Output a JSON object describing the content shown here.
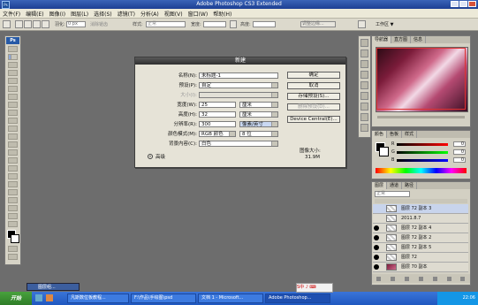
{
  "titlebar": {
    "title": "Adobe Photoshop CS3 Extended"
  },
  "menubar": {
    "items": [
      "文件(F)",
      "编辑(E)",
      "图像(I)",
      "图层(L)",
      "选择(S)",
      "滤镜(T)",
      "分析(A)",
      "视图(V)",
      "窗口(W)",
      "帮助(H)"
    ]
  },
  "optbar": {
    "feather_label": "羽化:",
    "feather_value": "0 px",
    "antialias_label": "消除锯齿",
    "style_label": "样式:",
    "style_value": "正常",
    "width_label": "宽度:",
    "height_label": "高度:",
    "refine_label": "调整边缘...",
    "workspace_label": "工作区 ▼"
  },
  "dialog": {
    "title": "新建",
    "name_label": "名称(N):",
    "name_value": "未标题-1",
    "preset_label": "预设(P):",
    "preset_value": "自定",
    "size_label": "大小(I):",
    "width_label": "宽度(W):",
    "width_value": "25",
    "width_unit": "厘米",
    "height_label": "高度(H):",
    "height_value": "32",
    "height_unit": "厘米",
    "resolution_label": "分辨率(R):",
    "resolution_value": "300",
    "resolution_unit": "像素/英寸",
    "colormode_label": "颜色模式(M):",
    "colormode_value": "RGB 颜色",
    "colormode_bits": "8 位",
    "background_label": "背景内容(C):",
    "background_value": "白色",
    "advanced_label": "高级",
    "buttons": {
      "ok": "确定",
      "cancel": "取消",
      "save_preset": "存储预设(S)...",
      "delete_preset": "删除预设(D)...",
      "device_central": "Device Central(E)..."
    },
    "image_size_label": "图像大小:",
    "image_size_value": "31.9M"
  },
  "navigator": {
    "tabs": [
      "导航器",
      "直方图",
      "信息"
    ]
  },
  "color_panel": {
    "tabs": [
      "颜色",
      "色板",
      "样式"
    ],
    "channels": [
      "R",
      "G",
      "B"
    ],
    "values": [
      "0",
      "0",
      "0"
    ]
  },
  "layers_panel": {
    "tabs": [
      "图层",
      "通道",
      "路径"
    ],
    "blend_mode": "正常",
    "layers": [
      "图层 72 副本 3",
      "2011.8.7",
      "图层 72 副本 4",
      "图层 72 副本 2",
      "图层 72 副本 5",
      "图层 72",
      "图层 70 副本"
    ]
  },
  "taskbar": {
    "start_label": "开始",
    "tasks": [
      "凡斯数位板教程...",
      "F:\\作品\\手绘图\\psd",
      "文档 1 - Microsoft...",
      "Adobe Photoshop..."
    ],
    "tray_time": "22:06",
    "docked_panel": "图层组..."
  },
  "colors": {
    "dialog_bg": "#e6e3d7",
    "workspace": "#6d6d6d",
    "taskbar": "#2a63cc"
  }
}
